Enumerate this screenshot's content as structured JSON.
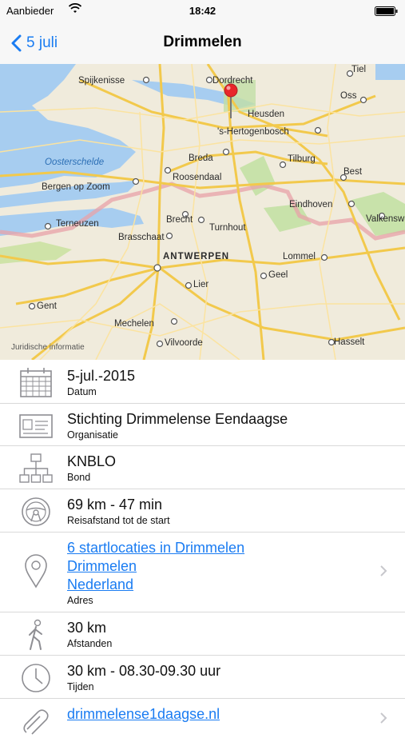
{
  "status_bar": {
    "carrier": "Aanbieder",
    "time": "18:42"
  },
  "nav": {
    "back_label": "5 juli",
    "title": "Drimmelen"
  },
  "map": {
    "legal": "Juridische informatie",
    "cities": [
      {
        "id": "spijkenisse",
        "name": "Spijkenisse"
      },
      {
        "id": "dordrecht",
        "name": "Dordrecht"
      },
      {
        "id": "tiel",
        "name": "Tiel"
      },
      {
        "id": "oss",
        "name": "Oss"
      },
      {
        "id": "heusden",
        "name": "Heusden"
      },
      {
        "id": "s-hertogenbosch",
        "name": "'s-Hertogenbosch"
      },
      {
        "id": "oosterschelde",
        "name": "Oosterschelde"
      },
      {
        "id": "breda",
        "name": "Breda"
      },
      {
        "id": "tilburg",
        "name": "Tilburg"
      },
      {
        "id": "roosendaal",
        "name": "Roosendaal"
      },
      {
        "id": "best",
        "name": "Best"
      },
      {
        "id": "bergen-op-zoom",
        "name": "Bergen op Zoom"
      },
      {
        "id": "eindhoven",
        "name": "Eindhoven"
      },
      {
        "id": "terneuzen",
        "name": "Terneuzen"
      },
      {
        "id": "brecht",
        "name": "Brecht"
      },
      {
        "id": "turnhout",
        "name": "Turnhout"
      },
      {
        "id": "valkenswaard",
        "name": "Valkenswa"
      },
      {
        "id": "brasschaat",
        "name": "Brasschaat"
      },
      {
        "id": "antwerpen",
        "name": "ANTWERPEN"
      },
      {
        "id": "lommel",
        "name": "Lommel"
      },
      {
        "id": "geel",
        "name": "Geel"
      },
      {
        "id": "lier",
        "name": "Lier"
      },
      {
        "id": "gent",
        "name": "Gent"
      },
      {
        "id": "mechelen",
        "name": "Mechelen"
      },
      {
        "id": "vilvoorde",
        "name": "Vilvoorde"
      },
      {
        "id": "hasselt",
        "name": "Hasselt"
      }
    ]
  },
  "details": [
    {
      "icon": "calendar-icon",
      "main": "5-jul.-2015",
      "sub": "Datum"
    },
    {
      "icon": "id-card-icon",
      "main": "Stichting Drimmelense Eendaagse",
      "sub": "Organisatie"
    },
    {
      "icon": "org-chart-icon",
      "main": "KNBLO",
      "sub": "Bond"
    },
    {
      "icon": "steering-wheel-icon",
      "main": "69 km - 47 min",
      "sub": "Reisafstand tot de start"
    },
    {
      "icon": "location-pin-icon",
      "links": [
        "6 startlocaties in Drimmelen",
        "Drimmelen",
        "Nederland"
      ],
      "sub": "Adres"
    },
    {
      "icon": "walking-person-icon",
      "main": "30 km",
      "sub": "Afstanden"
    },
    {
      "icon": "clock-icon",
      "main": "30 km - 08.30-09.30 uur",
      "sub": "Tijden"
    },
    {
      "icon": "link-icon",
      "link": "drimmelense1daagse.nl"
    }
  ]
}
